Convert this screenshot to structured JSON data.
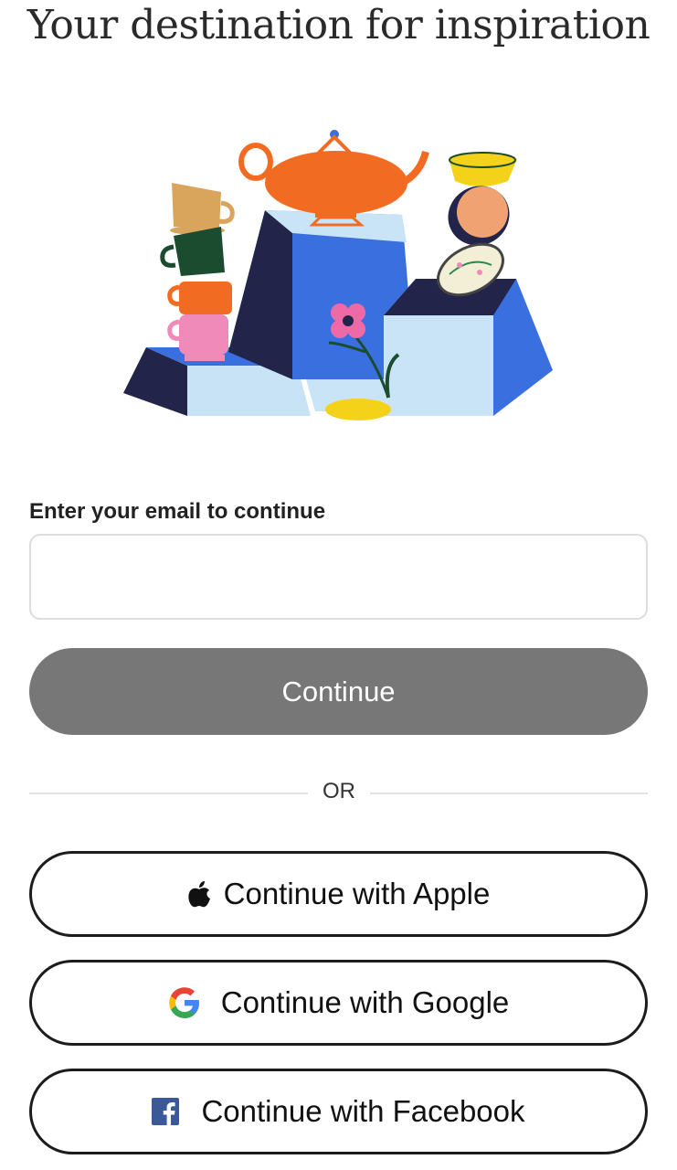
{
  "header": {
    "title": "Your destination for inspiration"
  },
  "hero": {
    "icon": "illustration-teapot-cups-pedestals"
  },
  "form": {
    "email_label": "Enter your email to continue",
    "email_value": "",
    "email_placeholder": "",
    "continue_label": "Continue",
    "continue_color": "#777777"
  },
  "divider": {
    "label": "OR"
  },
  "social": {
    "apple_label": "Continue with Apple",
    "google_label": "Continue with Google",
    "facebook_label": "Continue with Facebook",
    "apple_icon": "apple-icon",
    "google_icon": "google-icon",
    "facebook_icon": "facebook-icon",
    "facebook_color": "#3b5998"
  }
}
